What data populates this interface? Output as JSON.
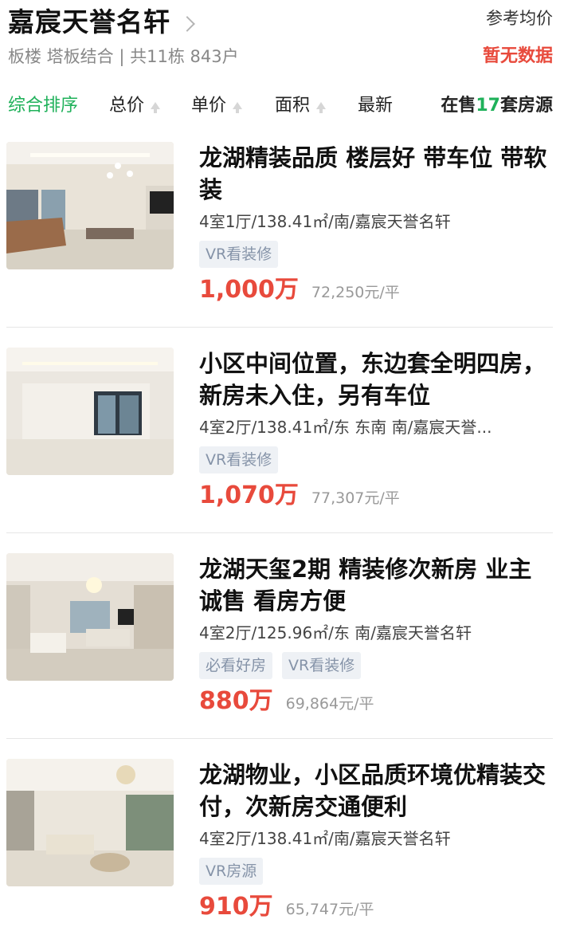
{
  "header": {
    "title": "嘉宸天誉名轩",
    "subtitle": "板楼 塔板结合 | 共11栋 843户",
    "avg_price_label": "参考均价",
    "avg_price_value": "暂无数据"
  },
  "sort": {
    "comprehensive": "综合排序",
    "total_price": "总价",
    "unit_price": "单价",
    "area": "面积",
    "latest": "最新"
  },
  "listing_count": {
    "prefix": "在售",
    "number": "17",
    "suffix": "套房源"
  },
  "listings": [
    {
      "title": "龙湖精装品质 楼层好 带车位 带软装",
      "meta": "4室1厅/138.41㎡/南/嘉宸天誉名轩",
      "tags": [
        "VR看装修"
      ],
      "price": "1,000万",
      "unit_price": "72,250元/平"
    },
    {
      "title": "小区中间位置，东边套全明四房，新房未入住，另有车位",
      "meta": "4室2厅/138.41㎡/东 东南 南/嘉宸天誉...",
      "tags": [
        "VR看装修"
      ],
      "price": "1,070万",
      "unit_price": "77,307元/平"
    },
    {
      "title": "龙湖天玺2期 精装修次新房 业主诚售 看房方便",
      "meta": "4室2厅/125.96㎡/东 南/嘉宸天誉名轩",
      "tags": [
        "必看好房",
        "VR看装修"
      ],
      "price": "880万",
      "unit_price": "69,864元/平"
    },
    {
      "title": "龙湖物业，小区品质环境优精装交付，次新房交通便利",
      "meta": "4室2厅/138.41㎡/南/嘉宸天誉名轩",
      "tags": [
        "VR房源"
      ],
      "price": "910万",
      "unit_price": "65,747元/平"
    }
  ],
  "colors": {
    "accent_green": "#1fb15a",
    "price_red": "#e84a3c",
    "tag_bg": "#eef1f5",
    "tag_text": "#8593a8"
  }
}
